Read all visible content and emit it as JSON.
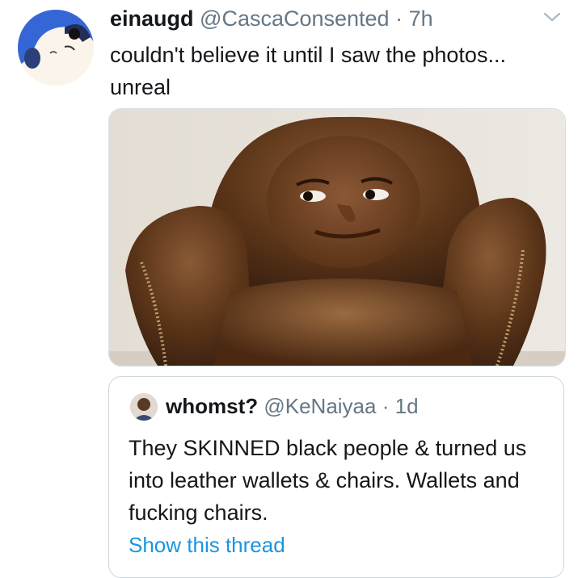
{
  "tweet": {
    "display_name": "einaugd",
    "handle": "@CascaConsented",
    "separator": "·",
    "time": "7h",
    "text": "couldn't believe it until I saw the photos... unreal",
    "avatar_icon": "cartoon-character-avatar",
    "menu_icon": "chevron-down-icon"
  },
  "quoted_tweet": {
    "display_name": "whomst?",
    "handle": "@KeNaiyaa",
    "separator": "·",
    "time": "1d",
    "text": "They SKINNED black people & turned us into leather wallets & chairs. Wallets and fucking chairs.",
    "show_thread": "Show this thread"
  },
  "colors": {
    "link": "#1b95e0",
    "secondary_text": "#657786",
    "border": "#ccd6dd"
  }
}
